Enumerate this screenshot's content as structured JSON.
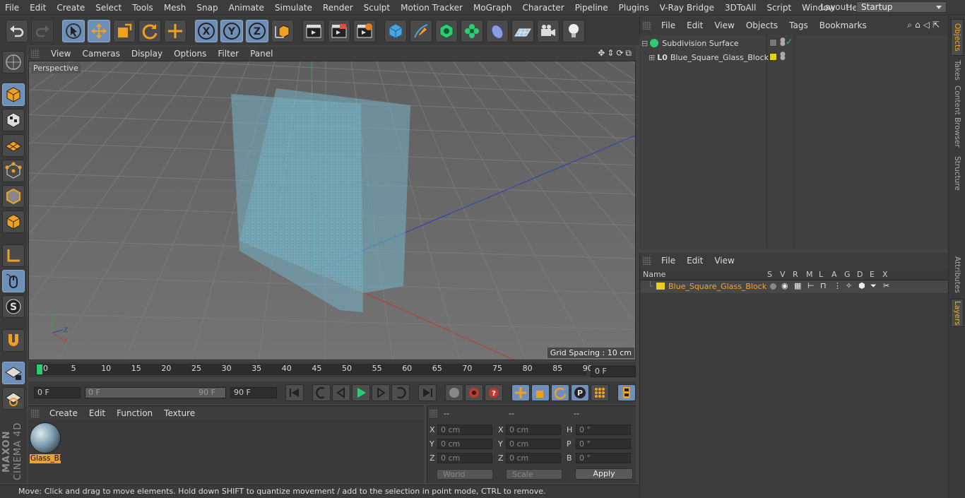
{
  "menubar": {
    "items": [
      "File",
      "Edit",
      "Create",
      "Select",
      "Tools",
      "Mesh",
      "Snap",
      "Animate",
      "Simulate",
      "Render",
      "Sculpt",
      "Motion Tracker",
      "MoGraph",
      "Character",
      "Pipeline",
      "Plugins",
      "V-Ray Bridge",
      "3DToAll",
      "Script",
      "Window",
      "Help"
    ],
    "layout_label": "Layout:",
    "layout_value": "Startup"
  },
  "toolbar": {
    "icons": [
      "undo-icon",
      "redo-icon",
      "live-selection-icon",
      "move-icon",
      "scale-icon",
      "rotate-icon",
      "recent-tools-icon",
      "x-axis-icon",
      "y-axis-icon",
      "z-axis-icon",
      "coordinate-system-icon",
      "render-view-icon",
      "render-picture-viewer-icon",
      "edit-render-settings-icon",
      "cube-icon",
      "pen-icon",
      "subdivision-icon",
      "cloner-icon",
      "deformer-icon",
      "floor-icon",
      "camera-icon",
      "light-icon"
    ],
    "axis_labels": [
      "X",
      "Y",
      "Z"
    ]
  },
  "viewport": {
    "menu": [
      "View",
      "Cameras",
      "Display",
      "Options",
      "Filter",
      "Panel"
    ],
    "label": "Perspective",
    "grid_spacing": "Grid Spacing : 10 cm",
    "colors": {
      "bg": "#6b6b6b",
      "x_axis": "#c0392b",
      "y_axis": "#27ae60",
      "z_axis": "#2a3fbf",
      "glass": "#79b6c9"
    }
  },
  "timeline": {
    "ticks": [
      "0",
      "5",
      "10",
      "15",
      "20",
      "25",
      "30",
      "35",
      "40",
      "45",
      "50",
      "55",
      "60",
      "65",
      "70",
      "75",
      "80",
      "85",
      "90"
    ],
    "current_frame": "0 F",
    "start_field": "0 F",
    "range_start": "0 F",
    "range_end": "90 F",
    "end_field": "90 F"
  },
  "material_manager": {
    "menu": [
      "Create",
      "Edit",
      "Function",
      "Texture"
    ],
    "material_name": "Glass_Bl"
  },
  "coordinates": {
    "headers": [
      "--",
      "--",
      "--"
    ],
    "rows": [
      {
        "a": "X",
        "av": "0 cm",
        "b": "X",
        "bv": "0 cm",
        "c": "H",
        "cv": "0 °"
      },
      {
        "a": "Y",
        "av": "0 cm",
        "b": "Y",
        "bv": "0 cm",
        "c": "P",
        "cv": "0 °"
      },
      {
        "a": "Z",
        "av": "0 cm",
        "b": "Z",
        "bv": "0 cm",
        "c": "B",
        "cv": "0 °"
      }
    ],
    "mode1": "World",
    "mode2": "Scale",
    "apply": "Apply"
  },
  "status": "Move: Click and drag to move elements. Hold down SHIFT to quantize movement / add to the selection in point mode, CTRL to remove.",
  "object_manager": {
    "menu": [
      "File",
      "Edit",
      "View",
      "Objects",
      "Tags",
      "Bookmarks"
    ],
    "objects": [
      {
        "name": "Subdivision Surface"
      },
      {
        "name": "Blue_Square_Glass_Block"
      }
    ]
  },
  "layer_manager": {
    "menu": [
      "File",
      "Edit",
      "View"
    ],
    "columns": [
      "Name",
      "S",
      "V",
      "R",
      "M",
      "L",
      "A",
      "G",
      "D",
      "E",
      "X"
    ],
    "layer_name": "Blue_Square_Glass_Block",
    "layer_color": "#e8d020"
  },
  "side_tabs": [
    "Objects",
    "Takes",
    "Content Browser",
    "Structure",
    "Attributes",
    "Layers"
  ],
  "brand": {
    "line1": "MAXON",
    "line2": "CINEMA 4D"
  }
}
